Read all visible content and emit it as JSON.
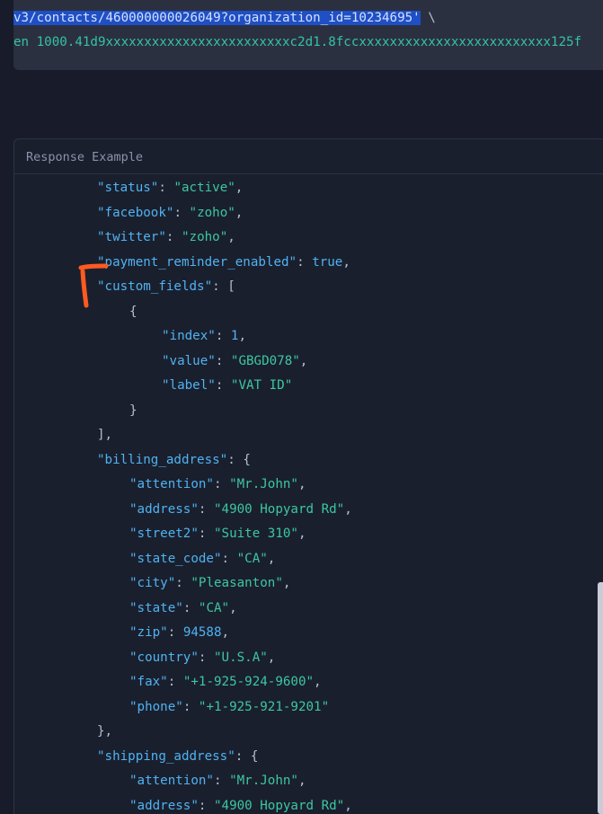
{
  "request": {
    "line1_selected": "v3/contacts/460000000026049?organization_id=10234695'",
    "line1_rest": " \\",
    "line2": "en 1000.41d9xxxxxxxxxxxxxxxxxxxxxxxxc2d1.8fccxxxxxxxxxxxxxxxxxxxxxxxxx125f"
  },
  "response": {
    "title": "Response Example",
    "lines": [
      {
        "indent": 0,
        "key": "status",
        "value": "active",
        "type": "str",
        "tail": ","
      },
      {
        "indent": 0,
        "key": "facebook",
        "value": "zoho",
        "type": "str",
        "tail": ","
      },
      {
        "indent": 0,
        "key": "twitter",
        "value": "zoho",
        "type": "str",
        "tail": ","
      },
      {
        "indent": 0,
        "key": "payment_reminder_enabled",
        "value": "true",
        "type": "bool",
        "tail": ","
      },
      {
        "indent": 0,
        "key": "custom_fields",
        "value": "[",
        "type": "punct",
        "tail": ""
      },
      {
        "indent": 1,
        "raw": "{"
      },
      {
        "indent": 2,
        "key": "index",
        "value": "1",
        "type": "num",
        "tail": ","
      },
      {
        "indent": 2,
        "key": "value",
        "value": "GBGD078",
        "type": "str",
        "tail": ","
      },
      {
        "indent": 2,
        "key": "label",
        "value": "VAT ID",
        "type": "str",
        "tail": ""
      },
      {
        "indent": 1,
        "raw": "}"
      },
      {
        "indent": 0,
        "raw": "],"
      },
      {
        "indent": 0,
        "key": "billing_address",
        "value": "{",
        "type": "punct",
        "tail": ""
      },
      {
        "indent": 1,
        "key": "attention",
        "value": "Mr.John",
        "type": "str",
        "tail": ","
      },
      {
        "indent": 1,
        "key": "address",
        "value": "4900 Hopyard Rd",
        "type": "str",
        "tail": ","
      },
      {
        "indent": 1,
        "key": "street2",
        "value": "Suite 310",
        "type": "str",
        "tail": ","
      },
      {
        "indent": 1,
        "key": "state_code",
        "value": "CA",
        "type": "str",
        "tail": ","
      },
      {
        "indent": 1,
        "key": "city",
        "value": "Pleasanton",
        "type": "str",
        "tail": ","
      },
      {
        "indent": 1,
        "key": "state",
        "value": "CA",
        "type": "str",
        "tail": ","
      },
      {
        "indent": 1,
        "key": "zip",
        "value": "94588",
        "type": "num",
        "tail": ","
      },
      {
        "indent": 1,
        "key": "country",
        "value": "U.S.A",
        "type": "str",
        "tail": ","
      },
      {
        "indent": 1,
        "key": "fax",
        "value": "+1-925-924-9600",
        "type": "str",
        "tail": ","
      },
      {
        "indent": 1,
        "key": "phone",
        "value": "+1-925-921-9201",
        "type": "str",
        "tail": ""
      },
      {
        "indent": 0,
        "raw": "},"
      },
      {
        "indent": 0,
        "key": "shipping_address",
        "value": "{",
        "type": "punct",
        "tail": ""
      },
      {
        "indent": 1,
        "key": "attention",
        "value": "Mr.John",
        "type": "str",
        "tail": ","
      },
      {
        "indent": 1,
        "key": "address",
        "value": "4900 Hopyard Rd",
        "type": "str",
        "tail": ","
      }
    ]
  },
  "colors": {
    "background": "#171b2a",
    "key": "#4fb3f0",
    "string": "#3cc7a0",
    "selection": "#1f4fc4",
    "annotation": "#ff5a1f"
  }
}
